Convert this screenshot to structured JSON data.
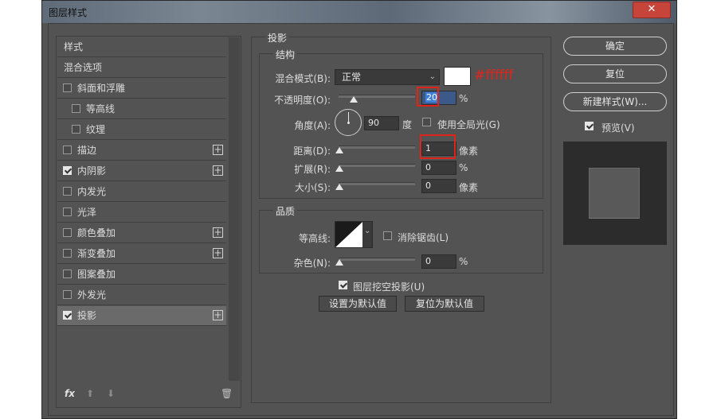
{
  "window": {
    "title": "图层样式",
    "close_label": "✕"
  },
  "left": {
    "items": [
      {
        "label": "样式",
        "has_checkbox": false,
        "checked": false,
        "indent": false,
        "plus": false,
        "selected": false
      },
      {
        "label": "混合选项",
        "has_checkbox": false,
        "checked": false,
        "indent": false,
        "plus": false,
        "selected": false
      },
      {
        "label": "斜面和浮雕",
        "has_checkbox": true,
        "checked": false,
        "indent": false,
        "plus": false,
        "selected": false
      },
      {
        "label": "等高线",
        "has_checkbox": true,
        "checked": false,
        "indent": true,
        "plus": false,
        "selected": false
      },
      {
        "label": "纹理",
        "has_checkbox": true,
        "checked": false,
        "indent": true,
        "plus": false,
        "selected": false
      },
      {
        "label": "描边",
        "has_checkbox": true,
        "checked": false,
        "indent": false,
        "plus": true,
        "selected": false
      },
      {
        "label": "内阴影",
        "has_checkbox": true,
        "checked": true,
        "indent": false,
        "plus": true,
        "selected": false
      },
      {
        "label": "内发光",
        "has_checkbox": true,
        "checked": false,
        "indent": false,
        "plus": false,
        "selected": false
      },
      {
        "label": "光泽",
        "has_checkbox": true,
        "checked": false,
        "indent": false,
        "plus": false,
        "selected": false
      },
      {
        "label": "颜色叠加",
        "has_checkbox": true,
        "checked": false,
        "indent": false,
        "plus": true,
        "selected": false
      },
      {
        "label": "渐变叠加",
        "has_checkbox": true,
        "checked": false,
        "indent": false,
        "plus": true,
        "selected": false
      },
      {
        "label": "图案叠加",
        "has_checkbox": true,
        "checked": false,
        "indent": false,
        "plus": false,
        "selected": false
      },
      {
        "label": "外发光",
        "has_checkbox": true,
        "checked": false,
        "indent": false,
        "plus": false,
        "selected": false
      },
      {
        "label": "投影",
        "has_checkbox": true,
        "checked": true,
        "indent": false,
        "plus": true,
        "selected": true
      }
    ],
    "footer": {
      "fx": "fx",
      "up": "⬆",
      "down": "⬇",
      "trash": "🗑"
    }
  },
  "shadow": {
    "title": "投影",
    "structure": {
      "title": "结构",
      "blend_mode_label": "混合模式(B):",
      "blend_mode_value": "正常",
      "color_annotation": "#ffffff",
      "opacity_label": "不透明度(O):",
      "opacity_value": "20",
      "opacity_unit": "%",
      "angle_label": "角度(A):",
      "angle_value": "90",
      "angle_unit": "度",
      "global_light_label": "使用全局光(G)",
      "distance_label": "距离(D):",
      "distance_value": "1",
      "distance_unit": "像素",
      "spread_label": "扩展(R):",
      "spread_value": "0",
      "spread_unit": "%",
      "size_label": "大小(S):",
      "size_value": "0",
      "size_unit": "像素"
    },
    "quality": {
      "title": "品质",
      "contour_label": "等高线:",
      "antialias_label": "消除锯齿(L)",
      "noise_label": "杂色(N):",
      "noise_value": "0",
      "noise_unit": "%"
    },
    "knockout_label": "图层挖空投影(U)",
    "make_default": "设置为默认值",
    "reset_default": "复位为默认值"
  },
  "right": {
    "ok": "确定",
    "reset": "复位",
    "new_style": "新建样式(W)...",
    "preview_label": "预览(V)"
  },
  "colors": {
    "accent_red": "#e2231a",
    "panel": "#535353"
  }
}
